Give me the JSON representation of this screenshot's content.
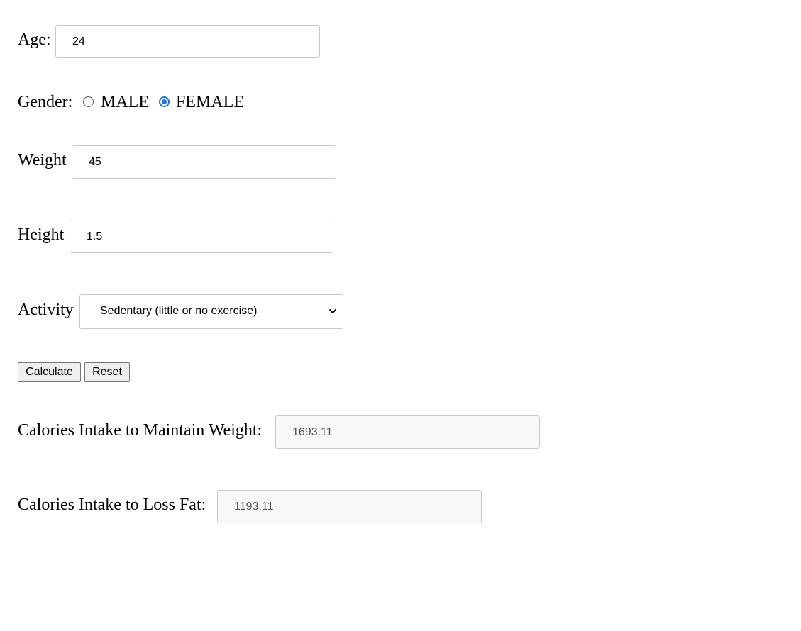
{
  "form": {
    "age": {
      "label": "Age:",
      "value": "24"
    },
    "gender": {
      "label": "Gender:",
      "options": [
        {
          "label": "MALE",
          "selected": false
        },
        {
          "label": "FEMALE",
          "selected": true
        }
      ]
    },
    "weight": {
      "label": "Weight",
      "value": "45"
    },
    "height": {
      "label": "Height",
      "value": "1.5"
    },
    "activity": {
      "label": "Activity",
      "selected": "Sedentary (little or no exercise)"
    },
    "buttons": {
      "calculate": "Calculate",
      "reset": "Reset"
    }
  },
  "results": {
    "maintain": {
      "label": "Calories Intake to Maintain Weight:",
      "value": "1693.11"
    },
    "loss": {
      "label": "Calories Intake to Loss Fat:",
      "value": "1193.11"
    }
  },
  "icons": {
    "select_arrow": "chevron-down-icon"
  },
  "colors": {
    "radio_accent": "#1a73e8",
    "readonly_bg": "#f8f8f8",
    "button_bg": "#efefef"
  }
}
